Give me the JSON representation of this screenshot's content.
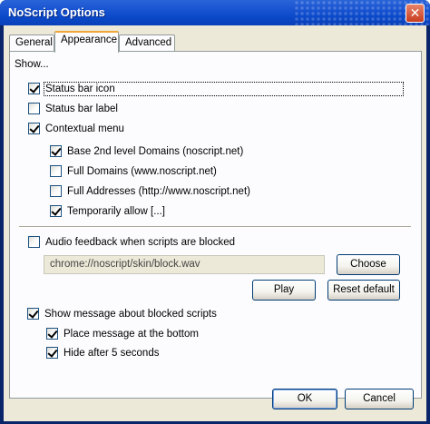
{
  "window": {
    "title": "NoScript Options"
  },
  "tabs": [
    {
      "label": "General"
    },
    {
      "label": "Appearance"
    },
    {
      "label": "Advanced"
    }
  ],
  "show_label": "Show...",
  "options": {
    "status_bar_icon": {
      "label": "Status bar icon",
      "checked": true
    },
    "status_bar_label": {
      "label": "Status bar label",
      "checked": false
    },
    "contextual_menu": {
      "label": "Contextual menu",
      "checked": true
    },
    "base_domains": {
      "label": "Base 2nd level Domains (noscript.net)",
      "checked": true
    },
    "full_domains": {
      "label": "Full Domains (www.noscript.net)",
      "checked": false
    },
    "full_addresses": {
      "label": "Full Addresses (http://www.noscript.net)",
      "checked": false
    },
    "temporarily_allow": {
      "label": "Temporarily allow [...]",
      "checked": true
    },
    "audio_feedback": {
      "label": "Audio feedback when scripts are blocked",
      "checked": false
    },
    "show_message": {
      "label": "Show message about blocked scripts",
      "checked": true
    },
    "place_bottom": {
      "label": "Place message at the bottom",
      "checked": true
    },
    "hide_after": {
      "label": "Hide after 5 seconds",
      "checked": true
    }
  },
  "sound_path": {
    "value": "chrome://noscript/skin/block.wav"
  },
  "buttons": {
    "choose": "Choose",
    "play": "Play",
    "reset_default": "Reset default",
    "ok": "OK",
    "cancel": "Cancel"
  }
}
